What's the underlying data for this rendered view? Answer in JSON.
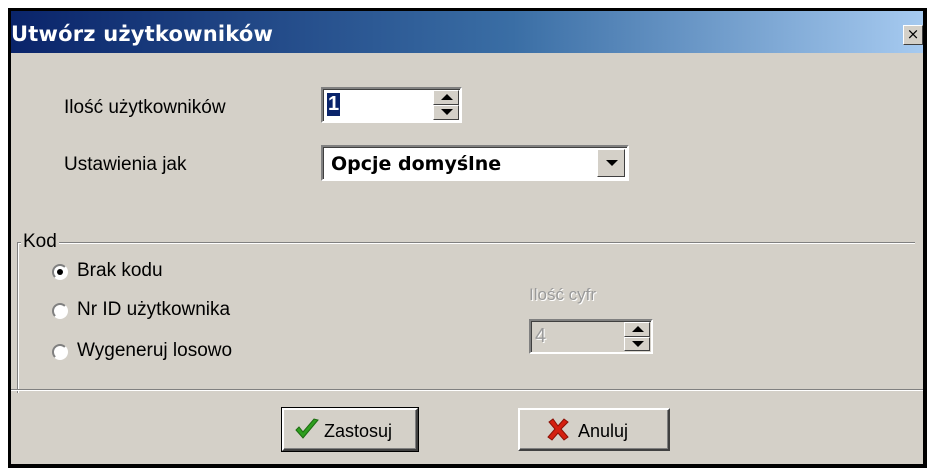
{
  "window": {
    "title": "Utwórz użytkowników",
    "close_glyph": "×"
  },
  "users_count": {
    "label": "Ilość użytkowników",
    "value": "1"
  },
  "settings_as": {
    "label": "Ustawienia jak",
    "selected": "Opcje domyślne"
  },
  "code_group": {
    "label": "Kod",
    "options": [
      {
        "label": "Brak kodu",
        "checked": true
      },
      {
        "label": "Nr ID użytkownika",
        "checked": false
      },
      {
        "label": "Wygeneruj losowo",
        "checked": false
      }
    ],
    "digits": {
      "label": "Ilość cyfr",
      "value": "4",
      "enabled": false
    }
  },
  "buttons": {
    "apply": "Zastosuj",
    "cancel": "Anuluj"
  },
  "icons": {
    "apply": "checkmark-icon",
    "cancel": "x-mark-icon"
  },
  "colors": {
    "title_start": "#0a246a",
    "title_end": "#a6caf0",
    "dialog_bg": "#d4d0c8",
    "apply_icon": "#2e9e1e",
    "cancel_icon": "#d42010"
  }
}
